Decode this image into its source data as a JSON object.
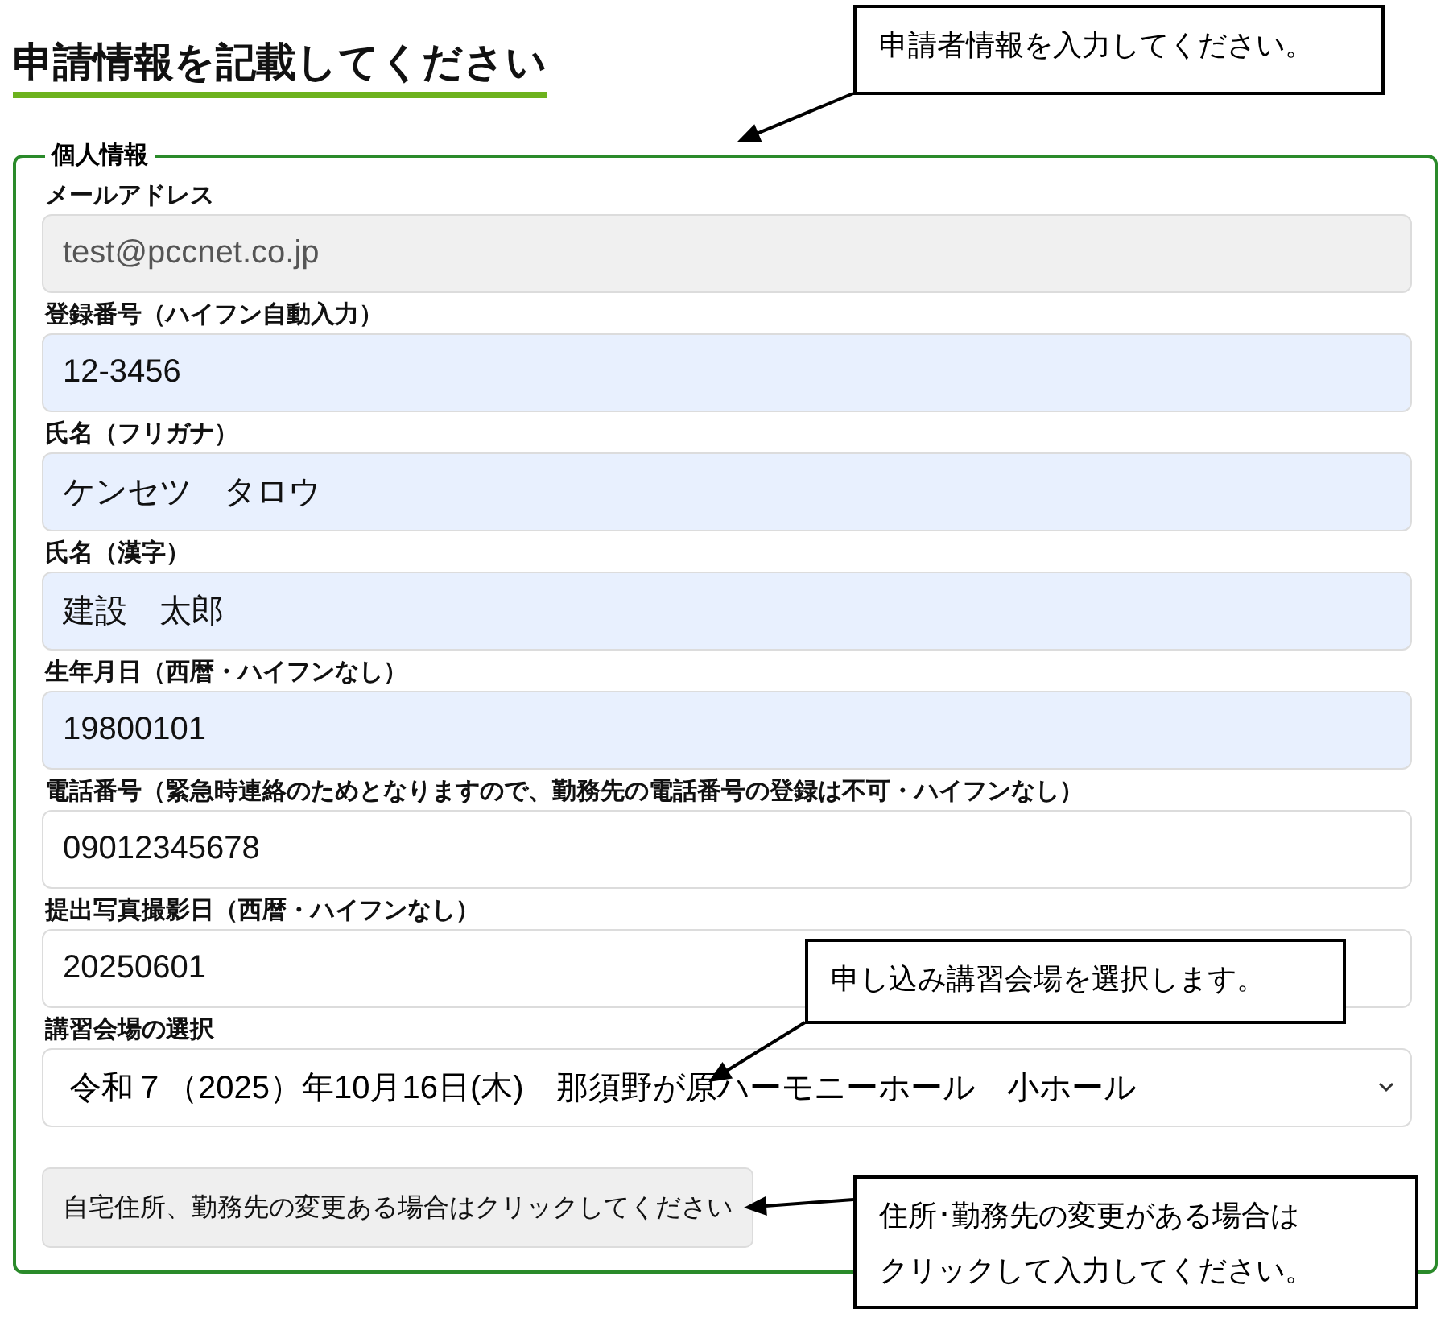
{
  "heading": "申請情報を記載してください",
  "fieldset": {
    "legend": "個人情報",
    "fields": [
      {
        "kind": "disabled",
        "label": "メールアドレス",
        "value": "test@pccnet.co.jp"
      },
      {
        "kind": "autofilled",
        "label": "登録番号（ハイフン自動入力）",
        "value": "12-3456"
      },
      {
        "kind": "autofilled",
        "label": "氏名（フリガナ）",
        "value": "ケンセツ　タロウ"
      },
      {
        "kind": "autofilled",
        "label": "氏名（漢字）",
        "value": "建設　太郎"
      },
      {
        "kind": "autofilled",
        "label": "生年月日（西暦・ハイフンなし）",
        "value": "19800101"
      },
      {
        "kind": "text",
        "label": "電話番号（緊急時連絡のためとなりますので、勤務先の電話番号の登録は不可・ハイフンなし）",
        "value": "09012345678"
      },
      {
        "kind": "text",
        "label": "提出写真撮影日（西暦・ハイフンなし）",
        "value": "20250601"
      },
      {
        "kind": "select",
        "label": "講習会場の選択",
        "value": "令和７（2025）年10月16日(木)　那須野が原ハーモニーホール　小ホール"
      }
    ],
    "button": "自宅住所、勤務先の変更ある場合はクリックしてください"
  },
  "callouts": [
    {
      "lines": [
        "申請者情報を入力してください。"
      ]
    },
    {
      "lines": [
        "申し込み講習会場を選択します。"
      ]
    },
    {
      "lines": [
        "住所･勤務先の変更がある場合は",
        "クリックして入力してください。"
      ]
    }
  ]
}
